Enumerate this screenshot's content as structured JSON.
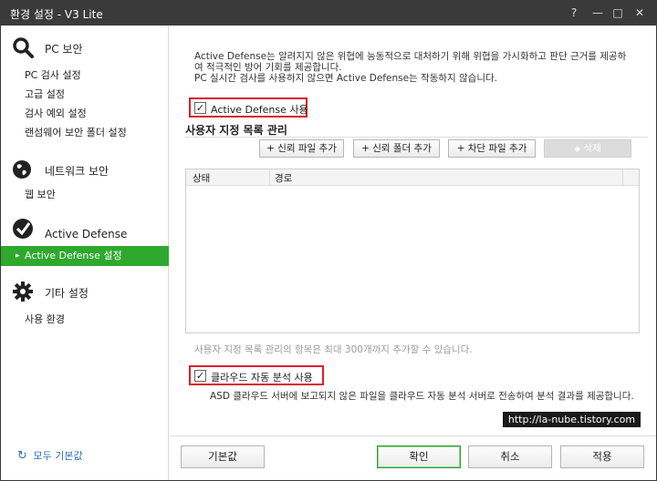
{
  "titlebar": {
    "title": "환경 설정 - V3 Lite",
    "help": "?",
    "minimize": "—",
    "maximize": "□",
    "close": "✕"
  },
  "sidebar": {
    "categories": [
      {
        "label": "PC 보안",
        "icon": "magnifier-icon",
        "items": [
          "PC 검사 설정",
          "고급 설정",
          "검사 예외 설정",
          "랜섬웨어 보안 폴더 설정"
        ]
      },
      {
        "label": "네트워크 보안",
        "icon": "globe-icon",
        "items": [
          "웹 보안"
        ]
      },
      {
        "label": "Active Defense",
        "icon": "shield-check-icon",
        "items": [
          "Active Defense 설정"
        ]
      },
      {
        "label": "기타 설정",
        "icon": "gear-icon",
        "items": [
          "사용 환경"
        ]
      }
    ],
    "reset_all": "모두 기본값"
  },
  "main": {
    "description": "Active Defense는 알려지지 않은 위협에 능동적으로 대처하기 위해 위협을 가시화하고 판단 근거를 제공하여 적극적인 방어 기회를 제공합니다.\nPC 실시간 검사를 사용하지 않으면 Active Defense는 작동하지 않습니다.",
    "use_checkbox": {
      "label": "Active Defense 사용",
      "checked": true
    },
    "section_title": "사용자 지정 목록 관리",
    "toolbar": {
      "add_trusted_file": "+ 신뢰 파일 추가",
      "add_trusted_folder": "+ 신뢰 폴더 추가",
      "add_block_file": "+ 차단 파일 추가",
      "delete": "삭제"
    },
    "table": {
      "columns": [
        "상태",
        "경로"
      ]
    },
    "note": "사용자 지정 목록 관리의 항목은 최대 300개까지 추가할 수 있습니다.",
    "cloud_checkbox": {
      "label": "클라우드 자동 분석 사용",
      "checked": true
    },
    "cloud_description": "ASD 클라우드 서버에 보고되지 않은 파일을 클라우드 자동 분석 서버로 전송하여 분석 결과를 제공합니다.",
    "watermark": "http://la-nube.tistory.com"
  },
  "footer": {
    "default": "기본값",
    "ok": "확인",
    "cancel": "취소",
    "apply": "적용"
  },
  "colors": {
    "accent": "#2fa82e",
    "titlebar": "#3a3a3a",
    "highlight": "#d9202a",
    "link": "#2d6fb5"
  }
}
